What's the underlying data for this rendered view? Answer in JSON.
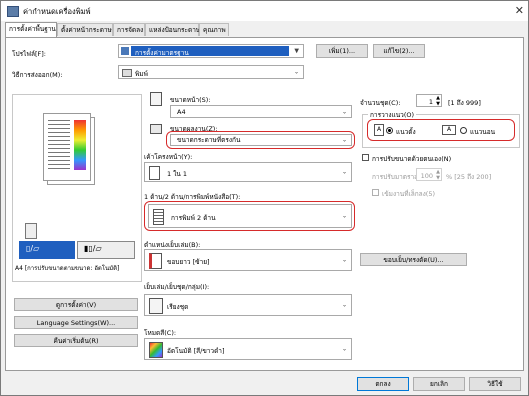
{
  "window": {
    "title": "ค่ากำหนดเครื่องพิมพ์",
    "close": "✕"
  },
  "tabs": [
    "การตั้งค่าพื้นฐาน",
    "ตั้งค่าหน้ากระดาษ",
    "การจัดลง",
    "แหล่งป้อนกระดาษ",
    "คุณภาพ"
  ],
  "profile": {
    "label": "โปรไฟล์[F]:",
    "value": "การตั้งค่ามาตรฐาน",
    "add": "เพิ่ม(1)...",
    "edit": "แก้ไข(2)..."
  },
  "output_method": {
    "label": "วิธีการส่งออก(M):",
    "value": "พิมพ์"
  },
  "page_size": {
    "label": "ขนาดหน้า(S):",
    "value": "A4"
  },
  "output_size": {
    "label": "ขนาดผลงาน(Z):",
    "value": "ขนาดกระดาษที่ตรงกัน"
  },
  "copies": {
    "label": "จำนวนชุด(C):",
    "value": "1",
    "range": "[1 ถึง 999]"
  },
  "orientation": {
    "group": "การวางแนว(O)",
    "portrait": "แนวตั้ง",
    "landscape": "แนวนอน"
  },
  "page_layout": {
    "label": "เค้าโครงหน้า(Y):",
    "value": "1 ใน 1"
  },
  "manual_scaling": {
    "label": "การปรับขนาดด้วยตนเอง(N)",
    "scaling_label": "การปรับมาตราส่วน(K):",
    "scaling_value": "100",
    "scaling_range": "% [25 ถึง 200]",
    "booklet": "เข้มงานที่เล็กลง(5)"
  },
  "duplex": {
    "label": "1 ด้าน/2 ด้าน/การพิมพ์หนังสือ(T):",
    "value": "การพิมพ์ 2 ด้าน"
  },
  "binding": {
    "label": "ตำแหน่งเย็บเล่ม(B):",
    "value": "ขอบยาว [ซ้าย]",
    "margin_button": "ขอบเย็บ/ทรงตัด(U)..."
  },
  "finishing": {
    "label": "เย็บเล่ม/เย็บชุด/กลุ่ม(I):",
    "value": "เรียงชุด"
  },
  "color_mode": {
    "label": "โหมดสี(C):",
    "value": "อัตโนมัติ [สี/ขาวดำ]"
  },
  "preview_caption": "A4 [การปรับขนาดตามขนาด: อัตโนมัติ]",
  "left_buttons": [
    "ดูการตั้งค่า(V)",
    "Language Settings(W)...",
    "คืนค่าเริ่มต้น(R)"
  ],
  "dialog_buttons": {
    "ok": "ตกลง",
    "cancel": "ยกเลิก",
    "help": "วิธีใช้"
  },
  "colors": {
    "highlight": "#d62b2b",
    "selection": "#1f5fbf",
    "accent": "#0078d7"
  }
}
